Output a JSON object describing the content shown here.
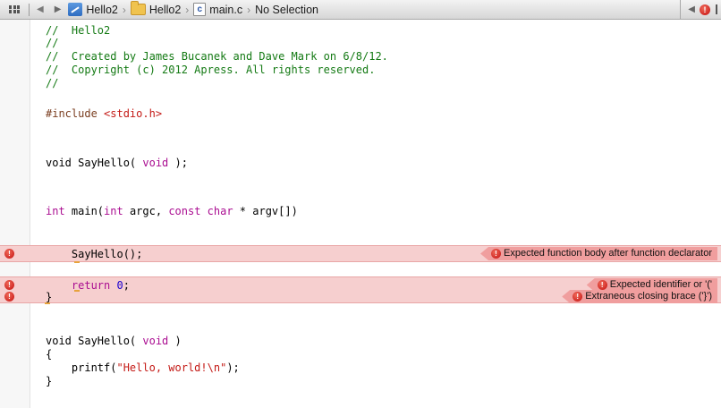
{
  "jumpbar": {
    "crumbs": [
      {
        "label": "Hello2",
        "icon": "project-icon"
      },
      {
        "label": "Hello2",
        "icon": "folder-icon"
      },
      {
        "label": "main.c",
        "icon": "c-file-icon"
      },
      {
        "label": "No Selection"
      }
    ],
    "file_badge": "c",
    "issue_badge": "!"
  },
  "code_lines": [
    {
      "text": "//  Hello2",
      "kind": "comment"
    },
    {
      "text": "//",
      "kind": "comment"
    },
    {
      "text": "//  Created by James Bucanek and Dave Mark on 6/8/12.",
      "kind": "comment"
    },
    {
      "text": "//  Copyright (c) 2012 Apress. All rights reserved.",
      "kind": "comment"
    },
    {
      "text": "//",
      "kind": "comment"
    },
    {
      "pp": "#include ",
      "str": "<stdio.h>"
    },
    {
      "a": "void SayHello( ",
      "kw": "void",
      "b": " );"
    },
    {
      "kw1": "int",
      "a": " main(",
      "kw2": "int",
      "b": " argc, ",
      "kw3": "const",
      "c": " ",
      "kw4": "char",
      "d": " * argv[])"
    },
    {
      "text": "    SayHello();"
    },
    {
      "kw": "    return",
      "a": " ",
      "num": "0",
      "b": ";"
    },
    {
      "text": "}"
    },
    {
      "text": "void SayHello( ",
      "kw": "void",
      "b": " )"
    },
    {
      "text": "{"
    },
    {
      "a": "    printf(",
      "str": "\"Hello, world!\\n\"",
      "b": ");"
    },
    {
      "text": "}"
    }
  ],
  "errors": [
    {
      "message": "Expected function body after function declarator",
      "icon": "!"
    },
    {
      "message": "Expected identifier or '('",
      "icon": "!"
    },
    {
      "message": "Extraneous closing brace ('}')",
      "icon": "!"
    }
  ],
  "colors": {
    "comment": "#147a14",
    "keyword": "#aa0d91",
    "string": "#c41a16",
    "number": "#1c00cf",
    "preprocessor": "#7a3d1f",
    "error_band": "#f6cfcf",
    "error_badge": "#c40f0f"
  }
}
